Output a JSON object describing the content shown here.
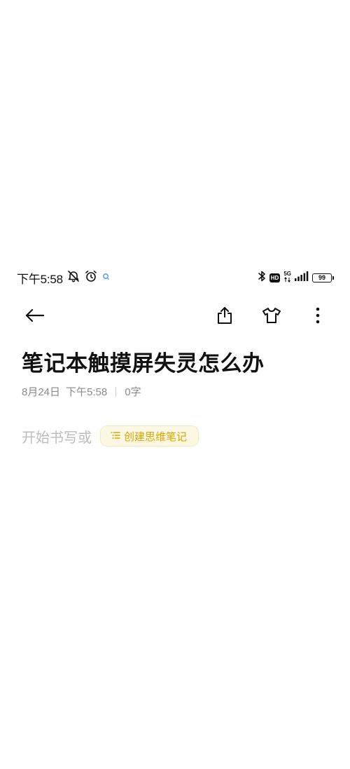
{
  "status_bar": {
    "time": "下午5:58",
    "network": "5G",
    "hd": "HD",
    "battery": "99"
  },
  "toolbar": {
    "icons": [
      "back-arrow-icon",
      "share-icon",
      "theme-shirt-icon",
      "more-vertical-icon"
    ]
  },
  "note": {
    "title": "笔记本触摸屏失灵怎么办",
    "date": "8月24日",
    "time": "下午5:58",
    "word_count": "0字",
    "placeholder": "开始书写或",
    "mindmap_button": "创建思维笔记"
  },
  "colors": {
    "accent": "#d9a600",
    "accent_bg": "#fdf8e4",
    "meta_text": "#8a8a8a",
    "placeholder_text": "#bdbdbd"
  }
}
